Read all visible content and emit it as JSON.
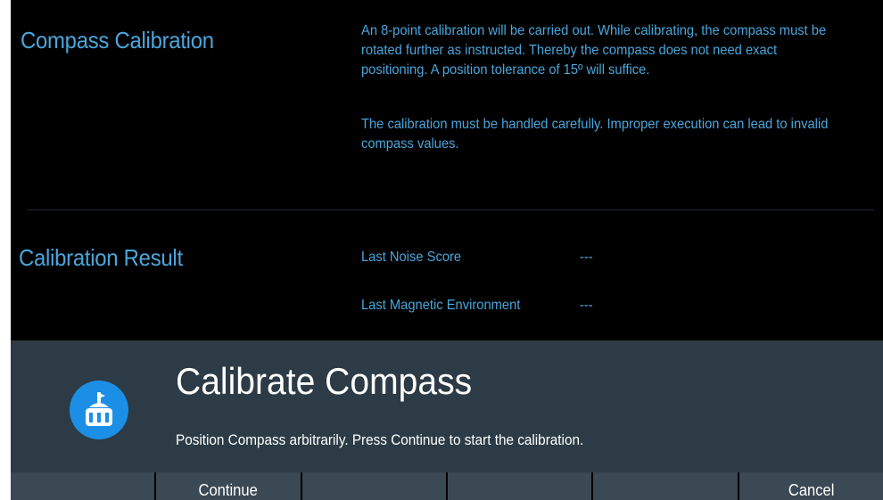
{
  "compass_calibration": {
    "title": "Compass Calibration",
    "paragraph1": "An 8-point calibration will be carried out. While calibrating, the compass must be rotated further as instructed. Thereby the compass does not need exact positioning. A position tolerance of 15º will suffice.",
    "paragraph2": "The calibration must be handled carefully. Improper execution can lead to invalid compass values."
  },
  "calibration_result": {
    "title": "Calibration Result",
    "rows": [
      {
        "label": "Last Noise Score",
        "value": "---"
      },
      {
        "label": "Last Magnetic Environment",
        "value": "---"
      }
    ]
  },
  "dialog": {
    "icon": "compass-icon",
    "title": "Calibrate Compass",
    "message": "Position Compass arbitrarily. Press Continue to start the calibration."
  },
  "softkeys": [
    "",
    "Continue",
    "",
    "",
    "",
    "Cancel"
  ],
  "colors": {
    "background": "#000000",
    "accent_text": "#4aa6dc",
    "dialog_bg": "#2c3b45",
    "softkey_bg": "#3a4954",
    "icon_bg": "#1b8fe6"
  }
}
